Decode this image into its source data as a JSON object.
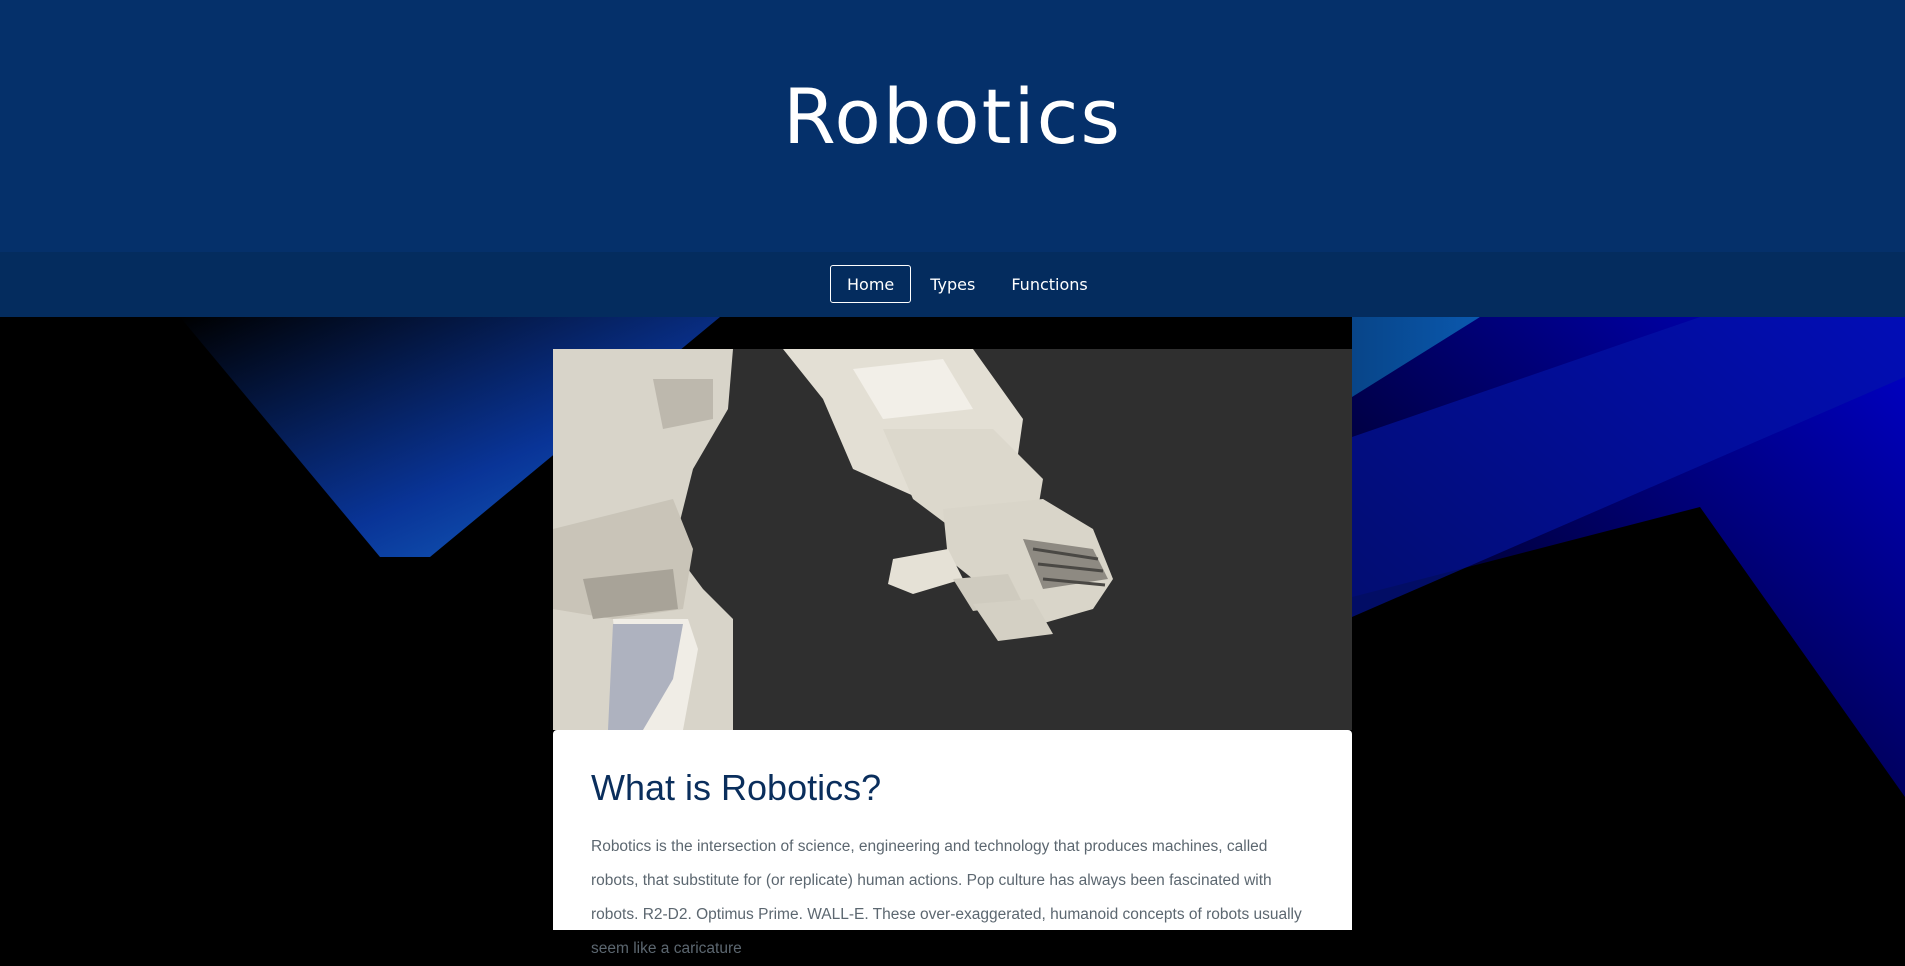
{
  "header": {
    "title": "Robotics"
  },
  "nav": {
    "items": [
      {
        "label": "Home",
        "active": true
      },
      {
        "label": "Types",
        "active": false
      },
      {
        "label": "Functions",
        "active": false
      }
    ]
  },
  "colors": {
    "header_bg": "#05306a",
    "navbar_bg": "#042c5e",
    "heading": "#0a2e5c",
    "accent_blue": "#0033cc"
  },
  "hero": {
    "image_icon": "robot-arm-image"
  },
  "article": {
    "heading": "What is Robotics?",
    "body": "Robotics is the intersection of science, engineering and technology that produces machines, called robots, that substitute for (or replicate) human actions. Pop culture has always been fascinated with robots. R2-D2. Optimus Prime. WALL-E. These over-exaggerated, humanoid concepts of robots usually seem like a caricature"
  }
}
